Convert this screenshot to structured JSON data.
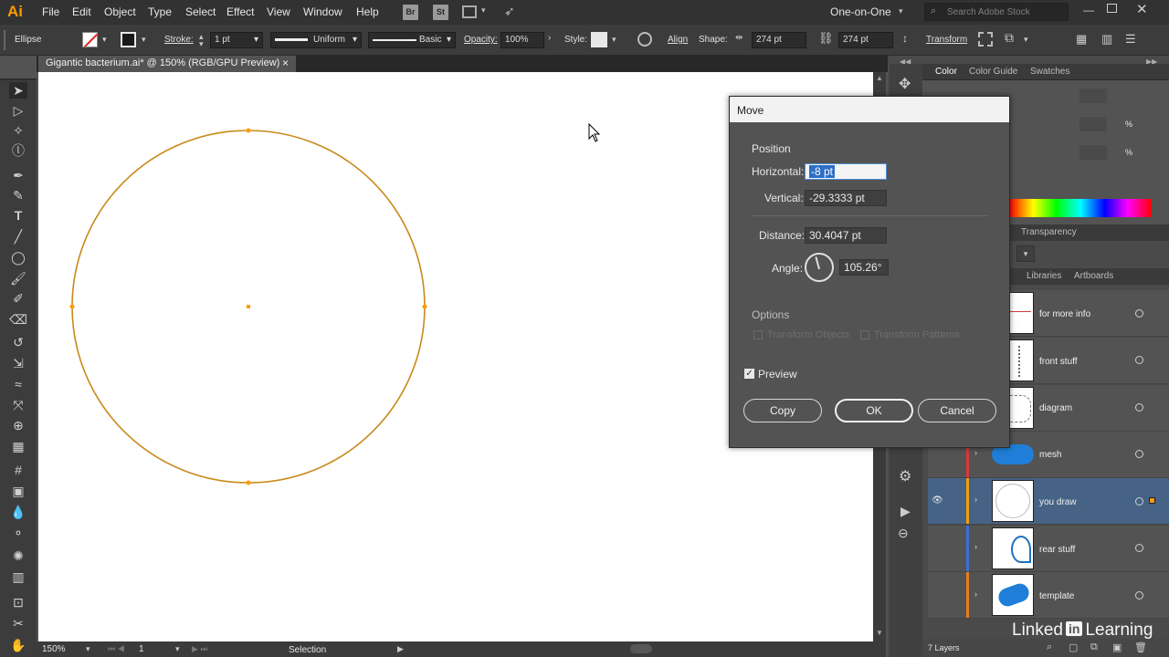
{
  "app": {
    "logo": "Ai",
    "menus": [
      "File",
      "Edit",
      "Object",
      "Type",
      "Select",
      "Effect",
      "View",
      "Window",
      "Help"
    ],
    "bridge": "Br",
    "stock": "St",
    "workspace": "One-on-One",
    "search_placeholder": "Search Adobe Stock"
  },
  "control": {
    "selection": "Ellipse",
    "stroke_label": "Stroke:",
    "stroke_value": "1 pt",
    "profile": "Uniform",
    "brush": "Basic",
    "opacity_label": "Opacity:",
    "opacity_value": "100%",
    "style_label": "Style:",
    "align": "Align",
    "shape_label": "Shape:",
    "width": "274 pt",
    "height": "274 pt",
    "transform": "Transform"
  },
  "document": {
    "tab_title": "Gigantic bacterium.ai* @ 150% (RGB/GPU Preview)",
    "close": "×"
  },
  "status": {
    "zoom": "150%",
    "artboard": "1",
    "tool": "Selection",
    "layers_count": "7 Layers"
  },
  "color_panel": {
    "tabs": [
      "Color",
      "Color Guide",
      "Swatches"
    ],
    "pct": "%"
  },
  "mid_tabs": {
    "transparency": "Transparency",
    "libraries": "Libraries",
    "artboards": "Artboards"
  },
  "layers": [
    {
      "name": "for more info",
      "color": "#d63a3a"
    },
    {
      "name": "front stuff",
      "color": "#d63a3a"
    },
    {
      "name": "diagram",
      "color": "#d63a3a"
    },
    {
      "name": "mesh",
      "color": "#d63a3a"
    },
    {
      "name": "you draw",
      "color": "#f39c12"
    },
    {
      "name": "rear stuff",
      "color": "#3b6fd8"
    },
    {
      "name": "template",
      "color": "#e67e22"
    }
  ],
  "dialog": {
    "title": "Move",
    "position": "Position",
    "horizontal_label": "Horizontal:",
    "horizontal_value": "-8 pt",
    "vertical_label": "Vertical:",
    "vertical_value": "-29.3333 pt",
    "distance_label": "Distance:",
    "distance_value": "30.4047 pt",
    "angle_label": "Angle:",
    "angle_value": "105.26°",
    "options": "Options",
    "transform_objects": "Transform Objects",
    "transform_patterns": "Transform Patterns",
    "preview": "Preview",
    "copy": "Copy",
    "ok": "OK",
    "cancel": "Cancel"
  },
  "watermark": "Linked Learning"
}
